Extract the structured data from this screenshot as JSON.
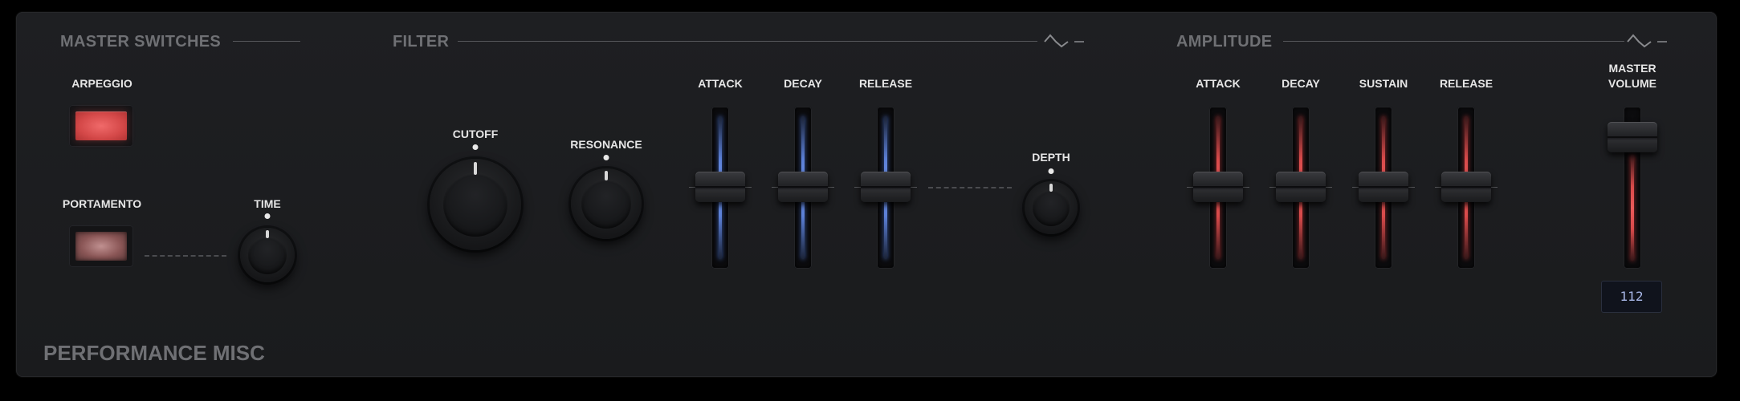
{
  "sections": {
    "master_switches": "MASTER SWITCHES",
    "filter": "FILTER",
    "amplitude": "AMPLITUDE"
  },
  "master": {
    "arpeggio_label": "ARPEGGIO",
    "arpeggio_state": "on",
    "portamento_label": "PORTAMENTO",
    "portamento_state": "off",
    "time_label": "TIME"
  },
  "filter": {
    "cutoff_label": "CUTOFF",
    "resonance_label": "RESONANCE",
    "attack_label": "ATTACK",
    "decay_label": "DECAY",
    "release_label": "RELEASE",
    "depth_label": "DEPTH",
    "accent_color": "#5b7fd6",
    "icon": "lfo-wave-icon"
  },
  "amplitude": {
    "attack_label": "ATTACK",
    "decay_label": "DECAY",
    "sustain_label": "SUSTAIN",
    "release_label": "RELEASE",
    "accent_color": "#d84a4a",
    "icon": "lfo-wave-icon"
  },
  "master_volume": {
    "label_line1": "MASTER",
    "label_line2": "VOLUME",
    "value": "112",
    "accent_color": "#d84a4a"
  },
  "footer": {
    "title": "PERFORMANCE MISC"
  }
}
